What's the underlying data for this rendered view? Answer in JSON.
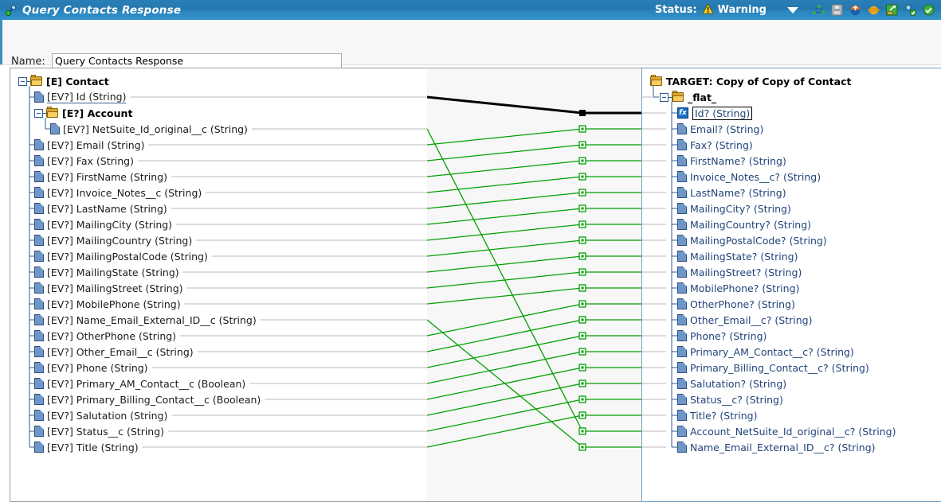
{
  "window": {
    "title": "Query Contacts Response",
    "title_icon": "mapping-icon",
    "status_label": "Status:",
    "status_value": "Warning",
    "status_icon": "warning-triangle-icon",
    "dropdown_icon": "chevron-down-icon",
    "toolbar_icons": [
      "graph-network-icon",
      "save-disk-icon",
      "deploy-globe-icon",
      "orange-sphere-icon",
      "export-folder-icon",
      "validate-icon",
      "check-circle-icon"
    ]
  },
  "name_field": {
    "label": "Name:",
    "value": "Query Contacts Response",
    "placeholder": "Name"
  },
  "source_tree": {
    "root": {
      "label": "[E] Contact",
      "icon": "folder-icon",
      "indent": 0,
      "expanded": true
    },
    "nodes": [
      {
        "label": "[EV?] Id (String)",
        "type": "leaf",
        "indent": 1,
        "underlined": true
      },
      {
        "label": "[E?] Account",
        "type": "folder",
        "indent": 1,
        "expanded": true
      },
      {
        "label": "[EV?] NetSuite_Id_original__c (String)",
        "type": "leaf",
        "indent": 2
      },
      {
        "label": "[EV?] Email (String)",
        "type": "leaf",
        "indent": 1
      },
      {
        "label": "[EV?] Fax (String)",
        "type": "leaf",
        "indent": 1
      },
      {
        "label": "[EV?] FirstName (String)",
        "type": "leaf",
        "indent": 1
      },
      {
        "label": "[EV?] Invoice_Notes__c (String)",
        "type": "leaf",
        "indent": 1
      },
      {
        "label": "[EV?] LastName (String)",
        "type": "leaf",
        "indent": 1
      },
      {
        "label": "[EV?] MailingCity (String)",
        "type": "leaf",
        "indent": 1
      },
      {
        "label": "[EV?] MailingCountry (String)",
        "type": "leaf",
        "indent": 1
      },
      {
        "label": "[EV?] MailingPostalCode (String)",
        "type": "leaf",
        "indent": 1
      },
      {
        "label": "[EV?] MailingState (String)",
        "type": "leaf",
        "indent": 1
      },
      {
        "label": "[EV?] MailingStreet (String)",
        "type": "leaf",
        "indent": 1
      },
      {
        "label": "[EV?] MobilePhone (String)",
        "type": "leaf",
        "indent": 1
      },
      {
        "label": "[EV?] Name_Email_External_ID__c (String)",
        "type": "leaf",
        "indent": 1
      },
      {
        "label": "[EV?] OtherPhone (String)",
        "type": "leaf",
        "indent": 1
      },
      {
        "label": "[EV?] Other_Email__c (String)",
        "type": "leaf",
        "indent": 1
      },
      {
        "label": "[EV?] Phone (String)",
        "type": "leaf",
        "indent": 1
      },
      {
        "label": "[EV?] Primary_AM_Contact__c (Boolean)",
        "type": "leaf",
        "indent": 1
      },
      {
        "label": "[EV?] Primary_Billing_Contact__c (Boolean)",
        "type": "leaf",
        "indent": 1
      },
      {
        "label": "[EV?] Salutation (String)",
        "type": "leaf",
        "indent": 1
      },
      {
        "label": "[EV?] Status__c (String)",
        "type": "leaf",
        "indent": 1
      },
      {
        "label": "[EV?] Title (String)",
        "type": "leaf",
        "indent": 1
      }
    ]
  },
  "target_tree": {
    "root": {
      "label": "TARGET: Copy of Copy of Contact",
      "icon": "folder-icon",
      "indent": 0
    },
    "flat": {
      "label": "_flat_",
      "icon": "folder-icon",
      "indent": 1,
      "expanded": true
    },
    "nodes": [
      {
        "label": "Id? (String)",
        "type": "fx",
        "selected": true
      },
      {
        "label": "Email? (String)",
        "type": "leaf"
      },
      {
        "label": "Fax? (String)",
        "type": "leaf"
      },
      {
        "label": "FirstName? (String)",
        "type": "leaf"
      },
      {
        "label": "Invoice_Notes__c? (String)",
        "type": "leaf"
      },
      {
        "label": "LastName? (String)",
        "type": "leaf"
      },
      {
        "label": "MailingCity? (String)",
        "type": "leaf"
      },
      {
        "label": "MailingCountry? (String)",
        "type": "leaf"
      },
      {
        "label": "MailingPostalCode? (String)",
        "type": "leaf"
      },
      {
        "label": "MailingState? (String)",
        "type": "leaf"
      },
      {
        "label": "MailingStreet? (String)",
        "type": "leaf"
      },
      {
        "label": "MobilePhone? (String)",
        "type": "leaf"
      },
      {
        "label": "OtherPhone? (String)",
        "type": "leaf"
      },
      {
        "label": "Other_Email__c? (String)",
        "type": "leaf"
      },
      {
        "label": "Phone? (String)",
        "type": "leaf"
      },
      {
        "label": "Primary_AM_Contact__c? (String)",
        "type": "leaf"
      },
      {
        "label": "Primary_Billing_Contact__c? (String)",
        "type": "leaf"
      },
      {
        "label": "Salutation? (String)",
        "type": "leaf"
      },
      {
        "label": "Status__c? (String)",
        "type": "leaf"
      },
      {
        "label": "Title? (String)",
        "type": "leaf"
      },
      {
        "label": "Account_NetSuite_Id_original__c? (String)",
        "type": "leaf"
      },
      {
        "label": "Name_Email_External_ID__c? (String)",
        "type": "leaf"
      }
    ]
  },
  "mapping": {
    "selected_color": "#000000",
    "line_color": "#00a000",
    "links": [
      {
        "source": "[EV?] Id (String)",
        "target": "Id? (String)",
        "selected": true
      },
      {
        "source": "[EV?] Email (String)",
        "target": "Email? (String)",
        "selected": false
      },
      {
        "source": "[EV?] Fax (String)",
        "target": "Fax? (String)",
        "selected": false
      },
      {
        "source": "[EV?] FirstName (String)",
        "target": "FirstName? (String)",
        "selected": false
      },
      {
        "source": "[EV?] Invoice_Notes__c (String)",
        "target": "Invoice_Notes__c? (String)",
        "selected": false
      },
      {
        "source": "[EV?] LastName (String)",
        "target": "LastName? (String)",
        "selected": false
      },
      {
        "source": "[EV?] MailingCity (String)",
        "target": "MailingCity? (String)",
        "selected": false
      },
      {
        "source": "[EV?] MailingCountry (String)",
        "target": "MailingCountry? (String)",
        "selected": false
      },
      {
        "source": "[EV?] MailingPostalCode (String)",
        "target": "MailingPostalCode? (String)",
        "selected": false
      },
      {
        "source": "[EV?] MailingState (String)",
        "target": "MailingState? (String)",
        "selected": false
      },
      {
        "source": "[EV?] MailingStreet (String)",
        "target": "MailingStreet? (String)",
        "selected": false
      },
      {
        "source": "[EV?] MobilePhone (String)",
        "target": "MobilePhone? (String)",
        "selected": false
      },
      {
        "source": "[EV?] OtherPhone (String)",
        "target": "OtherPhone? (String)",
        "selected": false
      },
      {
        "source": "[EV?] Other_Email__c (String)",
        "target": "Other_Email__c? (String)",
        "selected": false
      },
      {
        "source": "[EV?] Phone (String)",
        "target": "Phone? (String)",
        "selected": false
      },
      {
        "source": "[EV?] Primary_AM_Contact__c (Boolean)",
        "target": "Primary_AM_Contact__c? (String)",
        "selected": false
      },
      {
        "source": "[EV?] Primary_Billing_Contact__c (Boolean)",
        "target": "Primary_Billing_Contact__c? (String)",
        "selected": false
      },
      {
        "source": "[EV?] Salutation (String)",
        "target": "Salutation? (String)",
        "selected": false
      },
      {
        "source": "[EV?] Status__c (String)",
        "target": "Status__c? (String)",
        "selected": false
      },
      {
        "source": "[EV?] Title (String)",
        "target": "Title? (String)",
        "selected": false
      },
      {
        "source": "[EV?] NetSuite_Id_original__c (String)",
        "target": "Account_NetSuite_Id_original__c? (String)",
        "selected": false
      },
      {
        "source": "[EV?] Name_Email_External_ID__c (String)",
        "target": "Name_Email_External_ID__c? (String)",
        "selected": false
      }
    ]
  }
}
